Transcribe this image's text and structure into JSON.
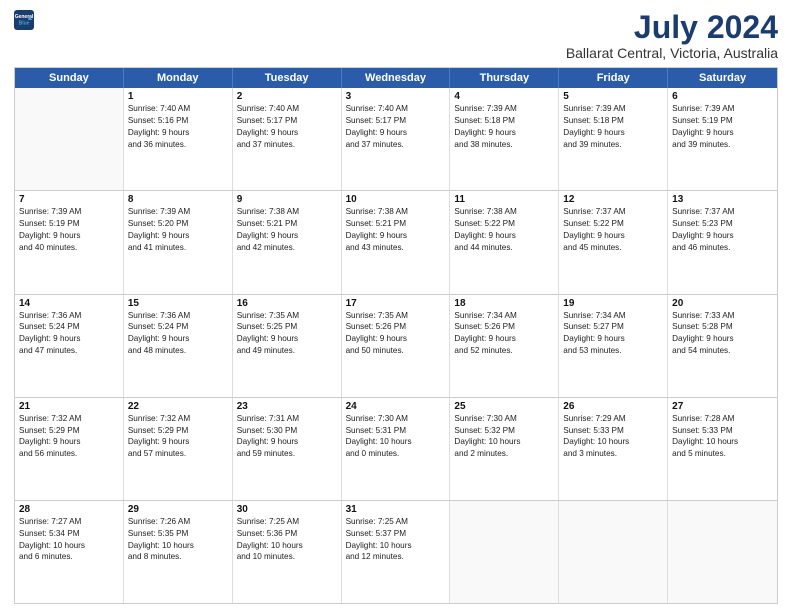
{
  "header": {
    "logo_line1": "General",
    "logo_line2": "Blue",
    "title": "July 2024",
    "subtitle": "Ballarat Central, Victoria, Australia"
  },
  "calendar": {
    "days_of_week": [
      "Sunday",
      "Monday",
      "Tuesday",
      "Wednesday",
      "Thursday",
      "Friday",
      "Saturday"
    ],
    "weeks": [
      [
        {
          "day": "",
          "empty": true,
          "lines": []
        },
        {
          "day": "1",
          "lines": [
            "Sunrise: 7:40 AM",
            "Sunset: 5:16 PM",
            "Daylight: 9 hours",
            "and 36 minutes."
          ]
        },
        {
          "day": "2",
          "lines": [
            "Sunrise: 7:40 AM",
            "Sunset: 5:17 PM",
            "Daylight: 9 hours",
            "and 37 minutes."
          ]
        },
        {
          "day": "3",
          "lines": [
            "Sunrise: 7:40 AM",
            "Sunset: 5:17 PM",
            "Daylight: 9 hours",
            "and 37 minutes."
          ]
        },
        {
          "day": "4",
          "lines": [
            "Sunrise: 7:39 AM",
            "Sunset: 5:18 PM",
            "Daylight: 9 hours",
            "and 38 minutes."
          ]
        },
        {
          "day": "5",
          "lines": [
            "Sunrise: 7:39 AM",
            "Sunset: 5:18 PM",
            "Daylight: 9 hours",
            "and 39 minutes."
          ]
        },
        {
          "day": "6",
          "lines": [
            "Sunrise: 7:39 AM",
            "Sunset: 5:19 PM",
            "Daylight: 9 hours",
            "and 39 minutes."
          ]
        }
      ],
      [
        {
          "day": "7",
          "lines": [
            "Sunrise: 7:39 AM",
            "Sunset: 5:19 PM",
            "Daylight: 9 hours",
            "and 40 minutes."
          ]
        },
        {
          "day": "8",
          "lines": [
            "Sunrise: 7:39 AM",
            "Sunset: 5:20 PM",
            "Daylight: 9 hours",
            "and 41 minutes."
          ]
        },
        {
          "day": "9",
          "lines": [
            "Sunrise: 7:38 AM",
            "Sunset: 5:21 PM",
            "Daylight: 9 hours",
            "and 42 minutes."
          ]
        },
        {
          "day": "10",
          "lines": [
            "Sunrise: 7:38 AM",
            "Sunset: 5:21 PM",
            "Daylight: 9 hours",
            "and 43 minutes."
          ]
        },
        {
          "day": "11",
          "lines": [
            "Sunrise: 7:38 AM",
            "Sunset: 5:22 PM",
            "Daylight: 9 hours",
            "and 44 minutes."
          ]
        },
        {
          "day": "12",
          "lines": [
            "Sunrise: 7:37 AM",
            "Sunset: 5:22 PM",
            "Daylight: 9 hours",
            "and 45 minutes."
          ]
        },
        {
          "day": "13",
          "lines": [
            "Sunrise: 7:37 AM",
            "Sunset: 5:23 PM",
            "Daylight: 9 hours",
            "and 46 minutes."
          ]
        }
      ],
      [
        {
          "day": "14",
          "lines": [
            "Sunrise: 7:36 AM",
            "Sunset: 5:24 PM",
            "Daylight: 9 hours",
            "and 47 minutes."
          ]
        },
        {
          "day": "15",
          "lines": [
            "Sunrise: 7:36 AM",
            "Sunset: 5:24 PM",
            "Daylight: 9 hours",
            "and 48 minutes."
          ]
        },
        {
          "day": "16",
          "lines": [
            "Sunrise: 7:35 AM",
            "Sunset: 5:25 PM",
            "Daylight: 9 hours",
            "and 49 minutes."
          ]
        },
        {
          "day": "17",
          "lines": [
            "Sunrise: 7:35 AM",
            "Sunset: 5:26 PM",
            "Daylight: 9 hours",
            "and 50 minutes."
          ]
        },
        {
          "day": "18",
          "lines": [
            "Sunrise: 7:34 AM",
            "Sunset: 5:26 PM",
            "Daylight: 9 hours",
            "and 52 minutes."
          ]
        },
        {
          "day": "19",
          "lines": [
            "Sunrise: 7:34 AM",
            "Sunset: 5:27 PM",
            "Daylight: 9 hours",
            "and 53 minutes."
          ]
        },
        {
          "day": "20",
          "lines": [
            "Sunrise: 7:33 AM",
            "Sunset: 5:28 PM",
            "Daylight: 9 hours",
            "and 54 minutes."
          ]
        }
      ],
      [
        {
          "day": "21",
          "lines": [
            "Sunrise: 7:32 AM",
            "Sunset: 5:29 PM",
            "Daylight: 9 hours",
            "and 56 minutes."
          ]
        },
        {
          "day": "22",
          "lines": [
            "Sunrise: 7:32 AM",
            "Sunset: 5:29 PM",
            "Daylight: 9 hours",
            "and 57 minutes."
          ]
        },
        {
          "day": "23",
          "lines": [
            "Sunrise: 7:31 AM",
            "Sunset: 5:30 PM",
            "Daylight: 9 hours",
            "and 59 minutes."
          ]
        },
        {
          "day": "24",
          "lines": [
            "Sunrise: 7:30 AM",
            "Sunset: 5:31 PM",
            "Daylight: 10 hours",
            "and 0 minutes."
          ]
        },
        {
          "day": "25",
          "lines": [
            "Sunrise: 7:30 AM",
            "Sunset: 5:32 PM",
            "Daylight: 10 hours",
            "and 2 minutes."
          ]
        },
        {
          "day": "26",
          "lines": [
            "Sunrise: 7:29 AM",
            "Sunset: 5:33 PM",
            "Daylight: 10 hours",
            "and 3 minutes."
          ]
        },
        {
          "day": "27",
          "lines": [
            "Sunrise: 7:28 AM",
            "Sunset: 5:33 PM",
            "Daylight: 10 hours",
            "and 5 minutes."
          ]
        }
      ],
      [
        {
          "day": "28",
          "lines": [
            "Sunrise: 7:27 AM",
            "Sunset: 5:34 PM",
            "Daylight: 10 hours",
            "and 6 minutes."
          ]
        },
        {
          "day": "29",
          "lines": [
            "Sunrise: 7:26 AM",
            "Sunset: 5:35 PM",
            "Daylight: 10 hours",
            "and 8 minutes."
          ]
        },
        {
          "day": "30",
          "lines": [
            "Sunrise: 7:25 AM",
            "Sunset: 5:36 PM",
            "Daylight: 10 hours",
            "and 10 minutes."
          ]
        },
        {
          "day": "31",
          "lines": [
            "Sunrise: 7:25 AM",
            "Sunset: 5:37 PM",
            "Daylight: 10 hours",
            "and 12 minutes."
          ]
        },
        {
          "day": "",
          "empty": true,
          "lines": []
        },
        {
          "day": "",
          "empty": true,
          "lines": []
        },
        {
          "day": "",
          "empty": true,
          "lines": []
        }
      ]
    ]
  }
}
